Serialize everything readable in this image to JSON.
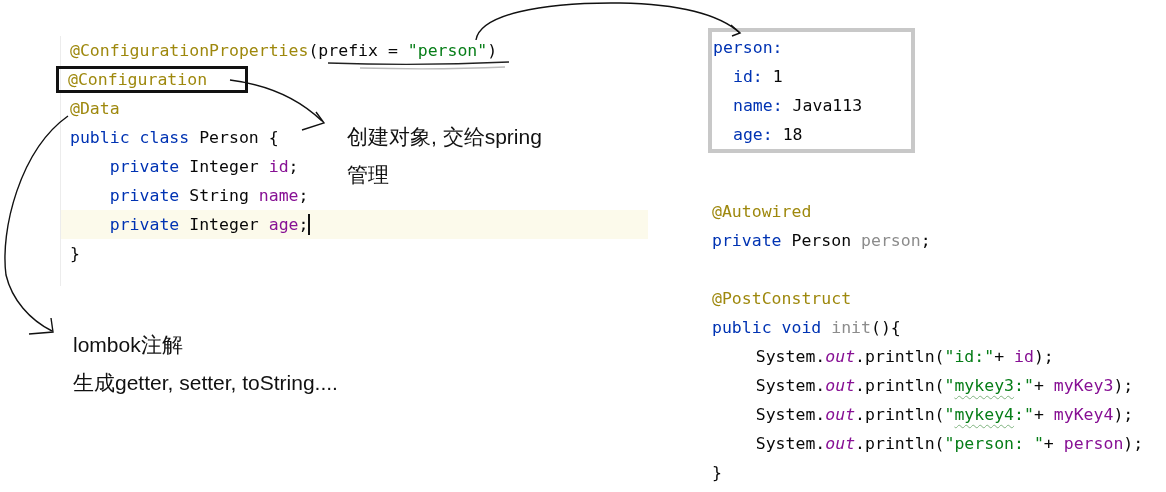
{
  "class_code": {
    "lines": [
      {
        "indented": false,
        "current": false,
        "boxed": false,
        "tokens": [
          {
            "text": "@ConfigurationProperties",
            "kind": "annotation"
          },
          {
            "text": "(prefix = ",
            "kind": "plain"
          },
          {
            "text": "\"person\"",
            "kind": "string"
          },
          {
            "text": ")",
            "kind": "plain"
          }
        ]
      },
      {
        "indented": false,
        "current": false,
        "boxed": true,
        "tokens": [
          {
            "text": "@Configuration",
            "kind": "annotation"
          }
        ]
      },
      {
        "indented": false,
        "current": false,
        "boxed": false,
        "tokens": [
          {
            "text": "@Data",
            "kind": "annotation"
          }
        ]
      },
      {
        "indented": false,
        "current": false,
        "boxed": false,
        "tokens": [
          {
            "text": "public class ",
            "kind": "keyword"
          },
          {
            "text": "Person {",
            "kind": "plain"
          }
        ]
      },
      {
        "indented": true,
        "current": false,
        "boxed": false,
        "tokens": [
          {
            "text": "private ",
            "kind": "keyword"
          },
          {
            "text": "Integer ",
            "kind": "plain"
          },
          {
            "text": "id",
            "kind": "field"
          },
          {
            "text": ";",
            "kind": "plain"
          }
        ]
      },
      {
        "indented": true,
        "current": false,
        "boxed": false,
        "tokens": [
          {
            "text": "private ",
            "kind": "keyword"
          },
          {
            "text": "String ",
            "kind": "plain"
          },
          {
            "text": "name",
            "kind": "field"
          },
          {
            "text": ";",
            "kind": "plain"
          }
        ]
      },
      {
        "indented": true,
        "current": true,
        "boxed": false,
        "tokens": [
          {
            "text": "private ",
            "kind": "keyword"
          },
          {
            "text": "Integer ",
            "kind": "plain"
          },
          {
            "text": "age",
            "kind": "field"
          },
          {
            "text": ";",
            "kind": "plain"
          }
        ]
      },
      {
        "indented": false,
        "current": false,
        "boxed": false,
        "tokens": [
          {
            "text": "}",
            "kind": "plain"
          }
        ]
      }
    ]
  },
  "yaml": [
    {
      "key": "person:",
      "children": [
        {
          "key": "id:",
          "value": "1"
        },
        {
          "key": "name:",
          "value": "Java113"
        },
        {
          "key": "age:",
          "value": "18"
        }
      ]
    }
  ],
  "field_code": {
    "lines": [
      {
        "indented": false,
        "tokens": [
          {
            "text": "@Autowired",
            "kind": "annotation"
          }
        ]
      },
      {
        "indented": false,
        "tokens": [
          {
            "text": "private ",
            "kind": "keyword"
          },
          {
            "text": "Person ",
            "kind": "plain"
          },
          {
            "text": "person",
            "kind": "unused"
          },
          {
            "text": ";",
            "kind": "plain"
          }
        ]
      }
    ]
  },
  "method_code": {
    "lines": [
      {
        "indented": false,
        "tokens": [
          {
            "text": "@PostConstruct",
            "kind": "annotation"
          }
        ]
      },
      {
        "indented": false,
        "tokens": [
          {
            "text": "public void ",
            "kind": "keyword"
          },
          {
            "text": "init",
            "kind": "unused"
          },
          {
            "text": "(){",
            "kind": "plain"
          }
        ]
      },
      {
        "indented": true,
        "tokens": [
          {
            "text": "System.",
            "kind": "plain"
          },
          {
            "text": "out",
            "kind": "static"
          },
          {
            "text": ".println(",
            "kind": "plain"
          },
          {
            "text": "\"id:\"",
            "kind": "string"
          },
          {
            "text": "+ ",
            "kind": "plain"
          },
          {
            "text": "id",
            "kind": "field"
          },
          {
            "text": ");",
            "kind": "plain"
          }
        ]
      },
      {
        "indented": true,
        "tokens": [
          {
            "text": "System.",
            "kind": "plain"
          },
          {
            "text": "out",
            "kind": "static"
          },
          {
            "text": ".println(",
            "kind": "plain"
          },
          {
            "text": "\"",
            "kind": "string"
          },
          {
            "text": "mykey3",
            "kind": "typo"
          },
          {
            "text": ":\"",
            "kind": "string"
          },
          {
            "text": "+ ",
            "kind": "plain"
          },
          {
            "text": "myKey3",
            "kind": "field"
          },
          {
            "text": ");",
            "kind": "plain"
          }
        ]
      },
      {
        "indented": true,
        "tokens": [
          {
            "text": "System.",
            "kind": "plain"
          },
          {
            "text": "out",
            "kind": "static"
          },
          {
            "text": ".println(",
            "kind": "plain"
          },
          {
            "text": "\"",
            "kind": "string"
          },
          {
            "text": "mykey4",
            "kind": "typo"
          },
          {
            "text": ":\"",
            "kind": "string"
          },
          {
            "text": "+ ",
            "kind": "plain"
          },
          {
            "text": "myKey4",
            "kind": "field"
          },
          {
            "text": ");",
            "kind": "plain"
          }
        ]
      },
      {
        "indented": true,
        "tokens": [
          {
            "text": "System.",
            "kind": "plain"
          },
          {
            "text": "out",
            "kind": "static"
          },
          {
            "text": ".println(",
            "kind": "plain"
          },
          {
            "text": "\"person: \"",
            "kind": "string"
          },
          {
            "text": "+ ",
            "kind": "plain"
          },
          {
            "text": "person",
            "kind": "field"
          },
          {
            "text": ");",
            "kind": "plain"
          }
        ]
      },
      {
        "indented": false,
        "tokens": [
          {
            "text": "}",
            "kind": "plain"
          }
        ]
      }
    ]
  },
  "notes": [
    {
      "kind": "spring",
      "lines": [
        "创建对象, 交给spring",
        "管理"
      ]
    },
    {
      "kind": "lombok",
      "lines": [
        "lombok注解",
        "生成getter, setter, toString...."
      ]
    }
  ]
}
